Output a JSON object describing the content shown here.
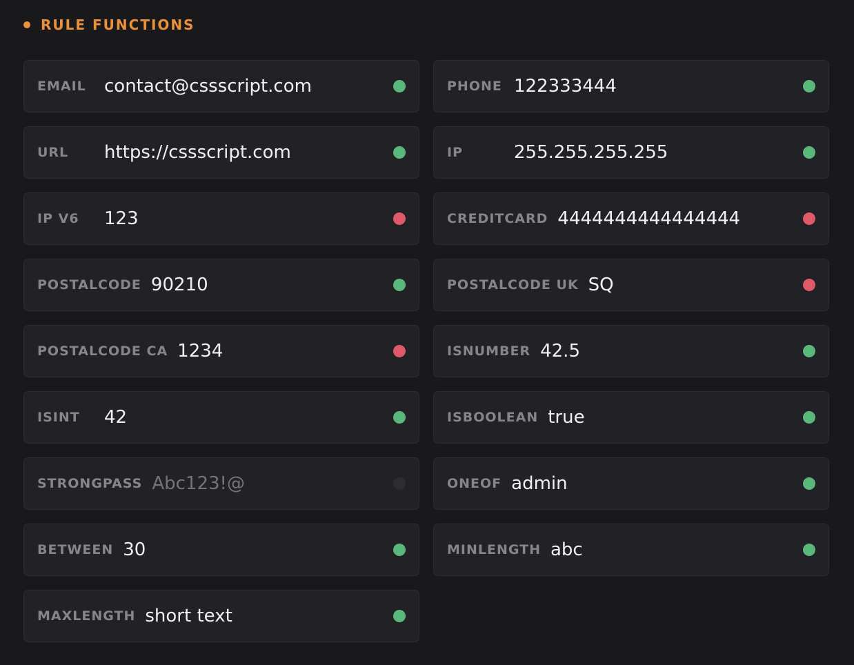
{
  "section": {
    "title": "RULE FUNCTIONS",
    "accent_color": "#e9913b"
  },
  "status_colors": {
    "valid": "#5cb87a",
    "invalid": "#df5a68",
    "neutral": "#2c2c31"
  },
  "fields": [
    {
      "label": "EMAIL",
      "value": "contact@cssscript.com",
      "status": "valid"
    },
    {
      "label": "PHONE",
      "value": "122333444",
      "status": "valid"
    },
    {
      "label": "URL",
      "value": "https://cssscript.com",
      "status": "valid"
    },
    {
      "label": "IP",
      "value": "255.255.255.255",
      "status": "valid"
    },
    {
      "label": "IP V6",
      "value": "123",
      "status": "invalid"
    },
    {
      "label": "CREDITCARD",
      "value": "4444444444444444",
      "status": "invalid"
    },
    {
      "label": "POSTALCODE",
      "value": "90210",
      "status": "valid"
    },
    {
      "label": "POSTALCODE UK",
      "value": "SQ",
      "status": "invalid"
    },
    {
      "label": "POSTALCODE CA",
      "value": "1234",
      "status": "invalid"
    },
    {
      "label": "ISNUMBER",
      "value": "42.5",
      "status": "valid"
    },
    {
      "label": "ISINT",
      "value": "42",
      "status": "valid"
    },
    {
      "label": "ISBOOLEAN",
      "value": "true",
      "status": "valid"
    },
    {
      "label": "STRONGPASS",
      "value": "Abc123!@",
      "status": "neutral"
    },
    {
      "label": "ONEOF",
      "value": "admin",
      "status": "valid"
    },
    {
      "label": "BETWEEN",
      "value": "30",
      "status": "valid"
    },
    {
      "label": "MINLENGTH",
      "value": "abc",
      "status": "valid"
    },
    {
      "label": "MAXLENGTH",
      "value": "short text",
      "status": "valid"
    }
  ]
}
